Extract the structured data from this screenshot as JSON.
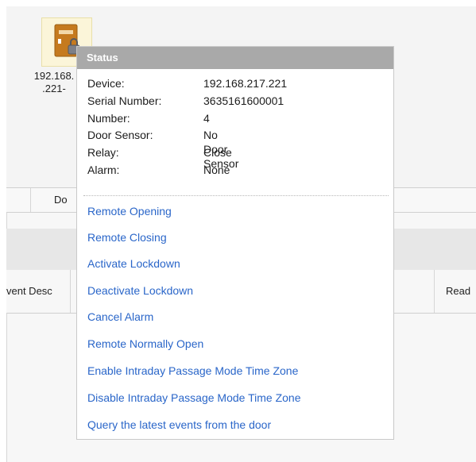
{
  "door": {
    "label_line1": "192.168.",
    "label_line2": ".221-",
    "icon": "door-lock-icon"
  },
  "grid": {
    "top_col": "Do",
    "event_col": "vent Desc",
    "read_col": "Read"
  },
  "popup": {
    "title": "Status",
    "fields": [
      {
        "label": "Device:",
        "value": "192.168.217.221"
      },
      {
        "label": "Serial Number:",
        "value": "3635161600001"
      },
      {
        "label": "Number:",
        "value": "4"
      },
      {
        "label": "Door Sensor:",
        "value": "No Door Sensor"
      },
      {
        "label": "Relay:",
        "value": "Close"
      },
      {
        "label": "Alarm:",
        "value": "None"
      }
    ],
    "actions": [
      "Remote Opening",
      "Remote Closing",
      "Activate Lockdown",
      "Deactivate Lockdown",
      "Cancel Alarm",
      "Remote Normally Open",
      "Enable Intraday Passage Mode Time Zone",
      "Disable Intraday Passage Mode Time Zone",
      "Query the latest events from the door"
    ]
  },
  "colors": {
    "link": "#2a66c9",
    "title_bar": "#a9a9a9",
    "door_icon": "#c57a1e"
  }
}
